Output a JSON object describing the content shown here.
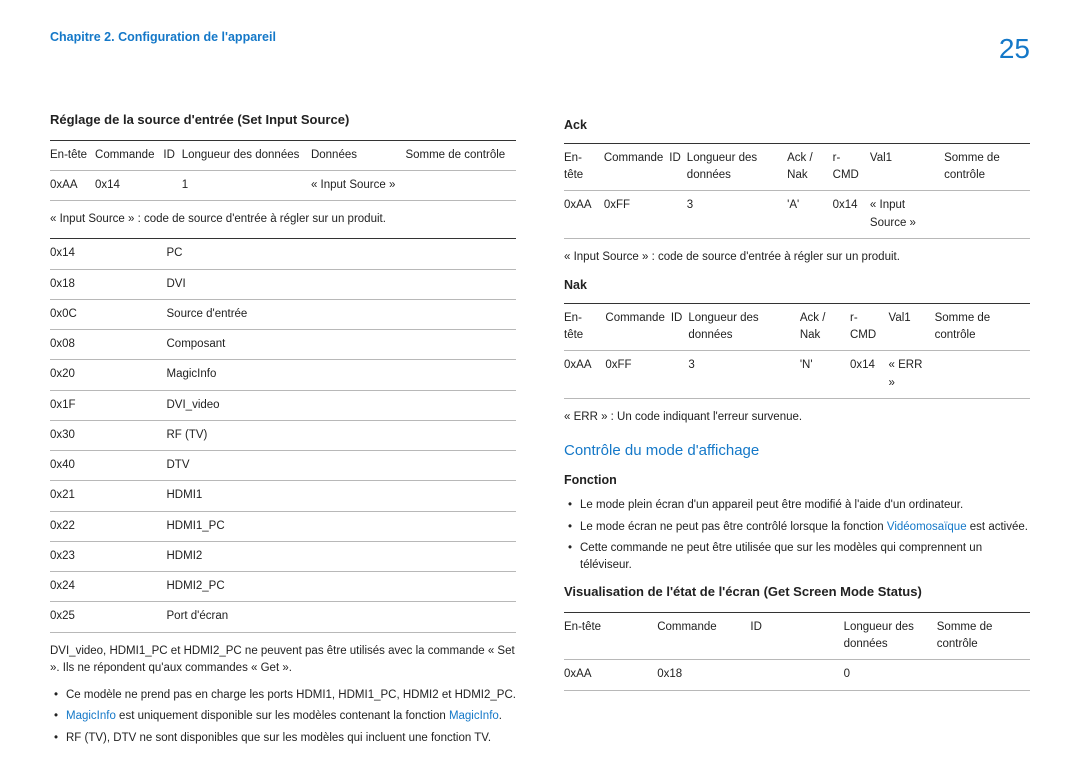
{
  "page": {
    "chapter": "Chapitre 2. Configuration de l'appareil",
    "number": "25"
  },
  "left": {
    "heading": "Réglage de la source d'entrée (Set Input Source)",
    "t1": {
      "h": [
        "En-tête",
        "Commande",
        "ID",
        "Longueur des données",
        "Données",
        "Somme de contrôle"
      ],
      "r": [
        "0xAA",
        "0x14",
        "",
        "1",
        "« Input Source »",
        ""
      ]
    },
    "t1_note": "« Input Source » : code de source d'entrée à régler sur un produit.",
    "codes": [
      [
        "0x14",
        "PC"
      ],
      [
        "0x18",
        "DVI"
      ],
      [
        "0x0C",
        "Source d'entrée"
      ],
      [
        "0x08",
        "Composant"
      ],
      [
        "0x20",
        "MagicInfo"
      ],
      [
        "0x1F",
        "DVI_video"
      ],
      [
        "0x30",
        "RF (TV)"
      ],
      [
        "0x40",
        "DTV"
      ],
      [
        "0x21",
        "HDMI1"
      ],
      [
        "0x22",
        "HDMI1_PC"
      ],
      [
        "0x23",
        "HDMI2"
      ],
      [
        "0x24",
        "HDMI2_PC"
      ],
      [
        "0x25",
        "Port d'écran"
      ]
    ],
    "para": "DVI_video, HDMI1_PC et HDMI2_PC ne peuvent pas être utilisés avec la commande « Set ». Ils ne répondent qu'aux commandes « Get ».",
    "b1_pre": "Ce modèle ne prend pas en charge les ports HDMI1, HDMI1_PC, HDMI2 et HDMI2_PC.",
    "b2_link1": "MagicInfo",
    "b2_mid": " est uniquement disponible sur les modèles contenant la fonction ",
    "b2_link2": "MagicInfo",
    "b2_end": ".",
    "b3": "RF (TV), DTV ne sont disponibles que sur les modèles qui incluent une fonction TV."
  },
  "right": {
    "ack_heading": "Ack",
    "ack": {
      "h": [
        "En-tête",
        "Commande",
        "ID",
        "Longueur des données",
        "Ack / Nak",
        "r-CMD",
        "Val1",
        "Somme de contrôle"
      ],
      "r": [
        "0xAA",
        "0xFF",
        "",
        "3",
        "'A'",
        "0x14",
        "« Input Source »",
        ""
      ]
    },
    "ack_note": "« Input Source » : code de source d'entrée à régler sur un produit.",
    "nak_heading": "Nak",
    "nak": {
      "h": [
        "En-tête",
        "Commande",
        "ID",
        "Longueur des données",
        "Ack / Nak",
        "r-CMD",
        "Val1",
        "Somme de contrôle"
      ],
      "r": [
        "0xAA",
        "0xFF",
        "",
        "3",
        "'N'",
        "0x14",
        "« ERR »",
        ""
      ]
    },
    "nak_note": "« ERR » : Un code indiquant l'erreur survenue.",
    "mode_heading": "Contrôle du mode d'affichage",
    "fn_heading": "Fonction",
    "fn_b1": "Le mode plein écran d'un appareil peut être modifié à l'aide d'un ordinateur.",
    "fn_b2_pre": "Le mode écran ne peut pas être contrôlé lorsque la fonction ",
    "fn_b2_link": "Vidéomosaïque",
    "fn_b2_post": " est activée.",
    "fn_b3": "Cette commande ne peut être utilisée que sur les modèles qui comprennent un téléviseur.",
    "vis_heading": "Visualisation de l'état de l'écran (Get Screen Mode Status)",
    "vis": {
      "h": [
        "En-tête",
        "Commande",
        "ID",
        "Longueur des données",
        "Somme de contrôle"
      ],
      "r": [
        "0xAA",
        "0x18",
        "",
        "0",
        ""
      ]
    }
  }
}
